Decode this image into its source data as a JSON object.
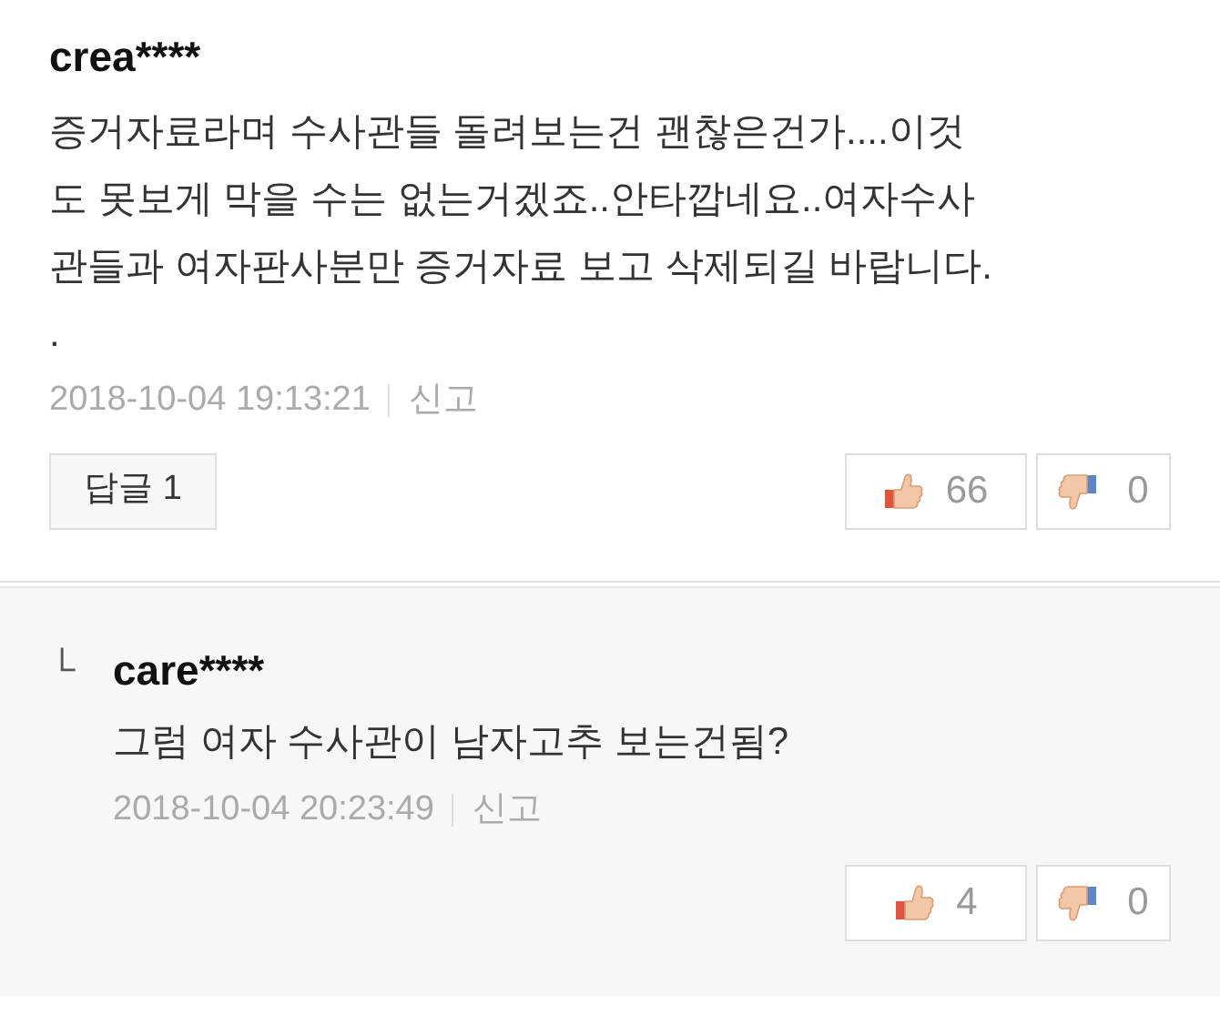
{
  "comment": {
    "author": "crea****",
    "lines": [
      "증거자료라며 수사관들 돌려보는건 괜찮은건가....이것",
      "도 못보게 막을 수는 없는거겠죠..안타깝네요..여자수사",
      "관들과 여자판사분만 증거자료 보고 삭제되길 바랍니다.",
      "."
    ],
    "date": "2018-10-04 19:13:21",
    "report": "신고",
    "reply_button": {
      "label": "답글",
      "count": "1"
    },
    "likes": "66",
    "dislikes": "0"
  },
  "replies": [
    {
      "marker": "└",
      "author": "care****",
      "text": "그럼 여자 수사관이 남자고추 보는건됨?",
      "date": "2018-10-04 20:23:49",
      "report": "신고",
      "likes": "4",
      "dislikes": "0"
    }
  ]
}
